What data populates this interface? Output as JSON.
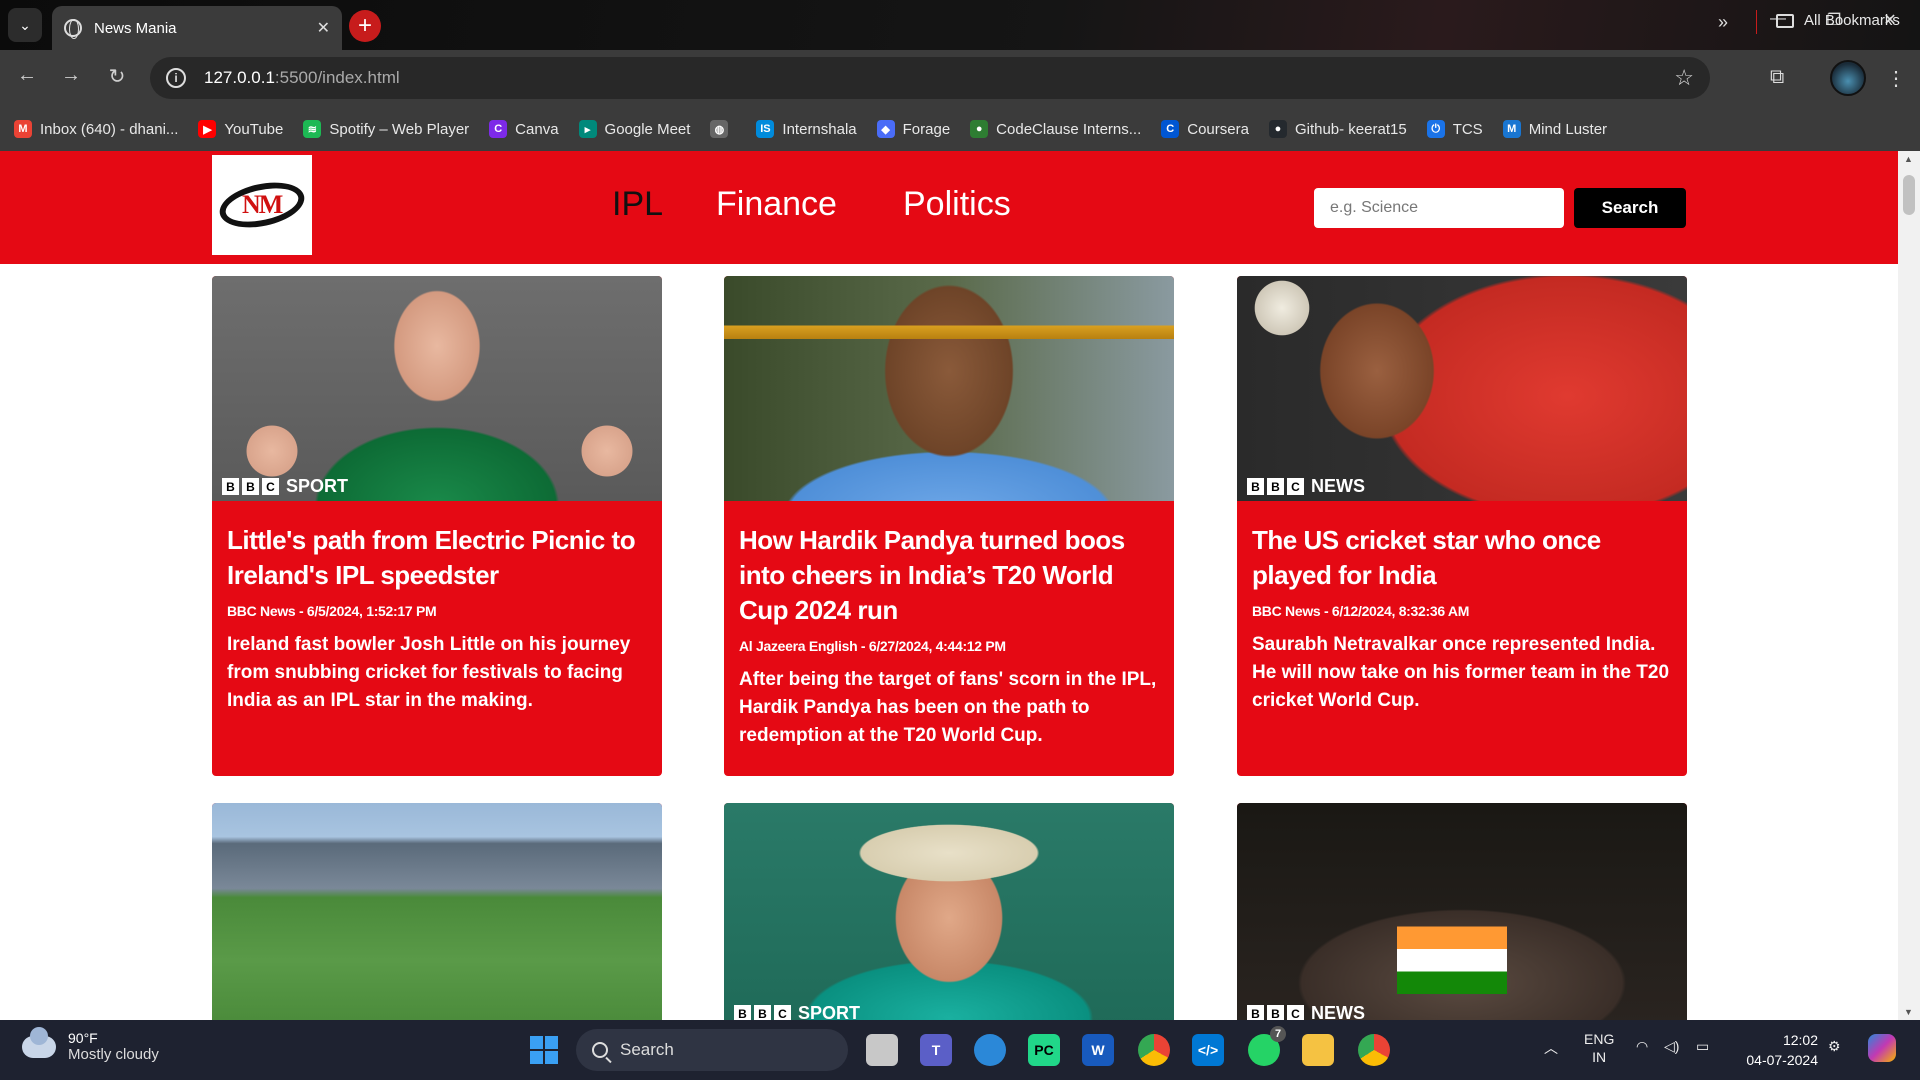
{
  "browser": {
    "tab_title": "News Mania",
    "tab_close": "✕",
    "new_tab": "+",
    "url_host": "127.0.0.1",
    "url_path": ":5500/index.html",
    "window_controls": [
      "—",
      "❐",
      "✕"
    ]
  },
  "bookmarks": [
    {
      "label": "Inbox (640) - dhani...",
      "icon": "gmail-icon",
      "color": "#ea4335",
      "glyph": "M"
    },
    {
      "label": "YouTube",
      "icon": "youtube-icon",
      "color": "#ff0000",
      "glyph": "▶"
    },
    {
      "label": "Spotify – Web Player",
      "icon": "spotify-icon",
      "color": "#1db954",
      "glyph": "≋"
    },
    {
      "label": "Canva",
      "icon": "canva-icon",
      "color": "#7d2ae8",
      "glyph": "C"
    },
    {
      "label": "Google Meet",
      "icon": "meet-icon",
      "color": "#00897b",
      "glyph": "▸"
    },
    {
      "label": "",
      "icon": "globe-icon",
      "color": "#666666",
      "glyph": "◍"
    },
    {
      "label": "Internshala",
      "icon": "internshala-icon",
      "color": "#008bdc",
      "glyph": "IS"
    },
    {
      "label": "Forage",
      "icon": "forage-icon",
      "color": "#4a6cf7",
      "glyph": "◆"
    },
    {
      "label": "CodeClause Interns...",
      "icon": "codeclause-icon",
      "color": "#2e7d32",
      "glyph": "●"
    },
    {
      "label": "Coursera",
      "icon": "coursera-icon",
      "color": "#0056d2",
      "glyph": "C"
    },
    {
      "label": "Github- keerat15",
      "icon": "github-icon",
      "color": "#24292e",
      "glyph": "●"
    },
    {
      "label": "TCS",
      "icon": "tcs-icon",
      "color": "#1a73e8",
      "glyph": "⏻"
    },
    {
      "label": "Mind Luster",
      "icon": "mindluster-icon",
      "color": "#1976d2",
      "glyph": "M"
    }
  ],
  "bookmarks_more": "»",
  "all_bookmarks": "All Bookmarks",
  "site": {
    "logo_text": "NM",
    "nav": [
      "IPL",
      "Finance",
      "Politics"
    ],
    "active_nav": "IPL",
    "search_placeholder": "e.g. Science",
    "search_button": "Search",
    "accent": "#e50914"
  },
  "articles": [
    {
      "title": "Little's path from Electric Picnic to Ireland's IPL speedster",
      "meta": "BBC News - 6/5/2024, 1:52:17 PM",
      "desc": "Ireland fast bowler Josh Little on his journey from snubbing cricket for festivals to facing India as an IPL star in the making.",
      "brand": "SPORT"
    },
    {
      "title": "How Hardik Pandya turned boos into cheers in India’s T20 World Cup 2024 run",
      "meta": "Al Jazeera English - 6/27/2024, 4:44:12 PM",
      "desc": "After being the target of fans' scorn in the IPL, Hardik Pandya has been on the path to redemption at the T20 World Cup.",
      "brand": ""
    },
    {
      "title": "The US cricket star who once played for India",
      "meta": "BBC News - 6/12/2024, 8:32:36 AM",
      "desc": "Saurabh Netravalkar once represented India. He will now take on his former team in the T20 cricket World Cup.",
      "brand": "NEWS"
    },
    {
      "title": "",
      "meta": "",
      "desc": "",
      "brand": ""
    },
    {
      "title": "",
      "meta": "",
      "desc": "",
      "brand": "SPORT"
    },
    {
      "title": "",
      "meta": "",
      "desc": "",
      "brand": "NEWS"
    }
  ],
  "taskbar": {
    "temp": "90°F",
    "weather": "Mostly cloudy",
    "search": "Search",
    "lang1": "ENG",
    "lang2": "IN",
    "time": "12:02",
    "date": "04-07-2024",
    "whatsapp_badge": "7"
  }
}
